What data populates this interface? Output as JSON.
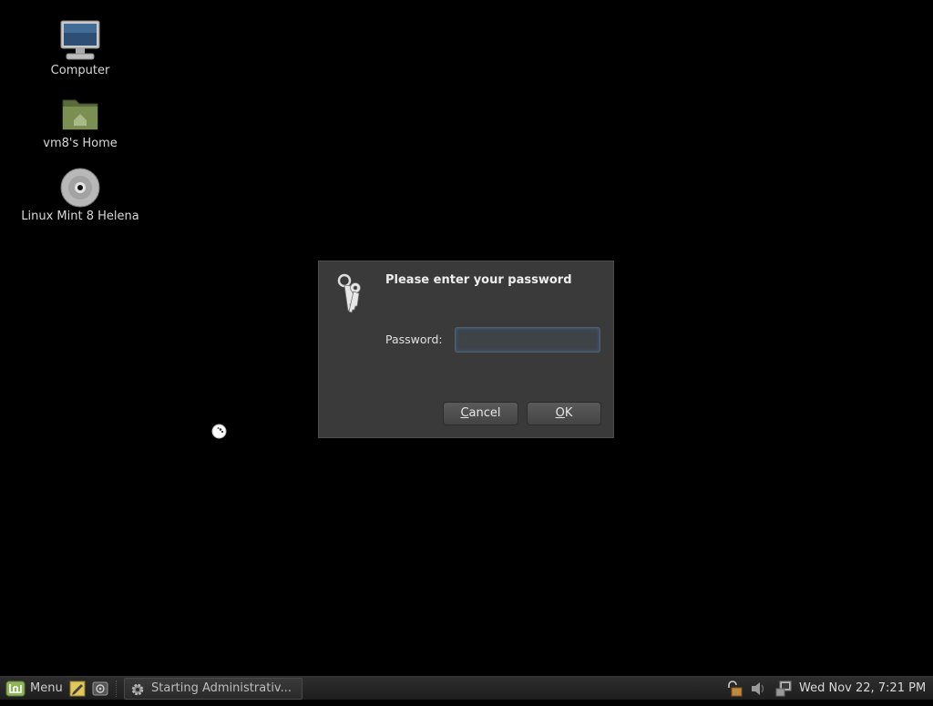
{
  "desktop": {
    "icons": [
      {
        "label": "Computer",
        "icon": "computer-icon"
      },
      {
        "label": "vm8's Home",
        "icon": "home-folder-icon"
      },
      {
        "label": "Linux Mint 8 Helena",
        "icon": "disc-icon"
      }
    ]
  },
  "dialog": {
    "title": "Please enter your password",
    "password_label": "Password:",
    "password_value": "",
    "cancel_label": "ancel",
    "cancel_mnemonic": "C",
    "ok_label": "K",
    "ok_mnemonic": "O",
    "icon": "keys-icon"
  },
  "taskbar": {
    "menu_label": "Menu",
    "task_label": "Starting Administrativ...",
    "clock": "Wed Nov 22,  7:21 PM"
  },
  "colors": {
    "desktop_bg": "#000000",
    "dialog_bg": "#3a3a3a",
    "mint_green": "#8fb45b",
    "input_focus": "#3c5c7a"
  }
}
